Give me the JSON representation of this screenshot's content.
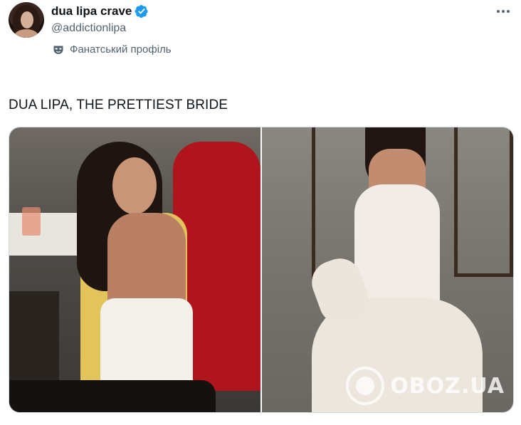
{
  "author": {
    "display_name": "dua lipa crave",
    "handle": "@addictionlipa",
    "verified_icon": "verified-badge-icon",
    "badge_color": "#1d9bf0"
  },
  "label": {
    "icon": "mask-icon",
    "text": "Фанатський профіль"
  },
  "tweet": {
    "text": "DUA LIPA, THE PRETTIEST BRIDE"
  },
  "media": {
    "count": 2,
    "watermark": "OBOZ.UA"
  },
  "colors": {
    "text_primary": "#0f1419",
    "text_secondary": "#536471",
    "border": "#cfd9de"
  }
}
